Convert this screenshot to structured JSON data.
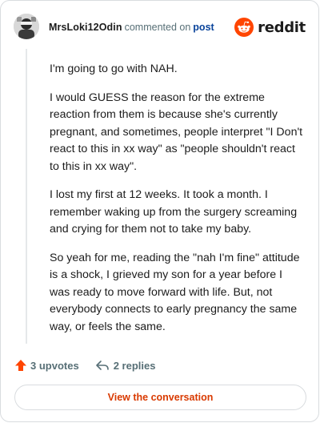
{
  "header": {
    "username": "MrsLoki12Odin",
    "action_text": "commented on",
    "post_link": "post",
    "brand_word": "reddit"
  },
  "comment": {
    "paragraphs": [
      "I'm going to go with NAH.",
      "I would GUESS the reason for the extreme reaction from them is because she's currently pregnant, and sometimes, people interpret \"I Don't react to this in xx way\" as \"people shouldn't react to this in xx way\".",
      "I lost my first at 12 weeks. It took a month. I remember waking up from the surgery screaming and crying for them not to take my baby.",
      "So yeah for me, reading the \"nah I'm fine\" attitude is a shock, I grieved my son for a year before I was ready to move forward with life. But, not everybody connects to early pregnancy the same way, or feels the same."
    ]
  },
  "footer": {
    "upvotes_label": "3 upvotes",
    "replies_label": "2 replies",
    "view_button_label": "View the conversation"
  },
  "icons": {
    "upvote": "upvote-arrow-icon",
    "reply": "reply-arrow-icon",
    "brand": "reddit-snoo-icon"
  },
  "colors": {
    "brand_orange": "#ff4500",
    "upvote_orange": "#ff4500",
    "link_blue": "#0a449b",
    "button_text": "#d93a00",
    "muted_text": "#576f76",
    "border": "#d9dcdf"
  }
}
